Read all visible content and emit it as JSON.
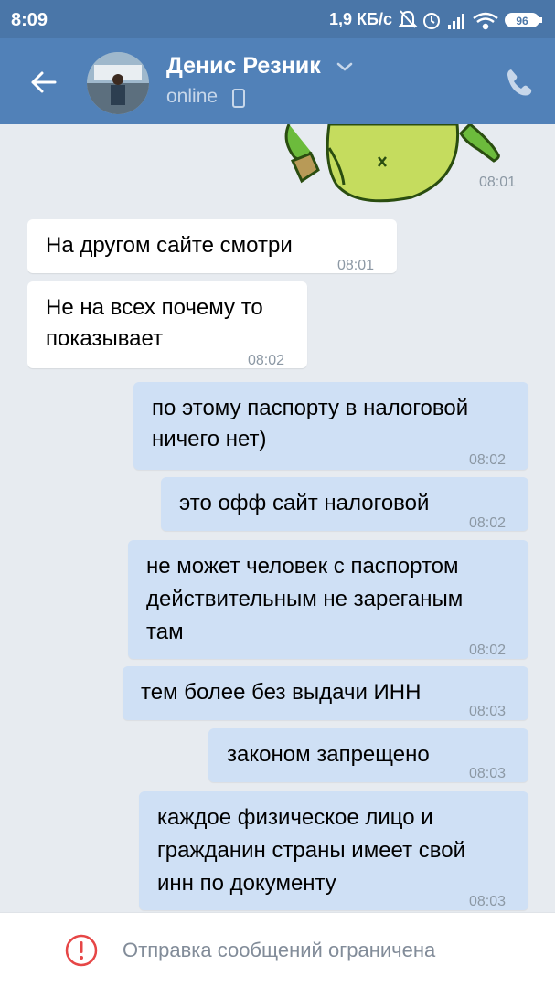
{
  "status_bar": {
    "time": "8:09",
    "network_speed": "1,9 КБ/с",
    "battery": "96",
    "icons": [
      "mute-icon",
      "alarm-icon",
      "signal-icon",
      "wifi-icon",
      "battery-icon"
    ]
  },
  "header": {
    "back_icon": "arrow-left-icon",
    "contact_name": "Денис Резник",
    "presence": "online",
    "call_icon": "phone-icon"
  },
  "messages": [
    {
      "dir": "in",
      "text": [
        "На другом сайте смотри"
      ],
      "time": "08:01"
    },
    {
      "dir": "in",
      "text": [
        "Не на всех почему то",
        "показывает"
      ],
      "time": "08:02"
    },
    {
      "dir": "out",
      "text": [
        "по этому паспорту в налоговой",
        "ничего нет)"
      ],
      "time": "08:02"
    },
    {
      "dir": "out",
      "text": [
        "это офф сайт налоговой"
      ],
      "time": "08:02"
    },
    {
      "dir": "out",
      "text": [
        "не может человек с паспортом",
        "действительным не зареганым",
        "там"
      ],
      "time": "08:02"
    },
    {
      "dir": "out",
      "text": [
        "тем более без выдачи ИНН"
      ],
      "time": "08:03"
    },
    {
      "dir": "out",
      "text": [
        "законом запрещено"
      ],
      "time": "08:03"
    },
    {
      "dir": "out",
      "text": [
        "каждое физическое лицо и",
        "гражданин страны имеет свой",
        "инн по документу"
      ],
      "time": "08:03"
    }
  ],
  "sticker": {
    "time": "08:01"
  },
  "footer": {
    "icon": "exclamation-circle-icon",
    "text": "Отправка сообщений ограничена",
    "accent": "#e64646"
  },
  "colors": {
    "status_bar": "#4a76a8",
    "header": "#5181b8",
    "chat_bg": "#e7ebf0",
    "incoming": "#ffffff",
    "outgoing": "#cfe0f5"
  }
}
